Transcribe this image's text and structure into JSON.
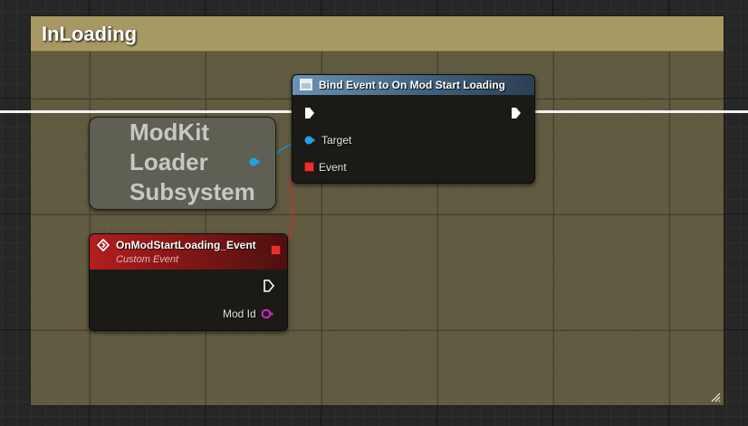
{
  "comment": {
    "title": "InLoading"
  },
  "bind_node": {
    "title": "Bind Event to On Mod Start Loading",
    "pins": {
      "target_label": "Target",
      "event_label": "Event"
    }
  },
  "variable_node": {
    "label": "ModKit Loader Subsystem"
  },
  "event_node": {
    "title": "OnModStartLoading_Event",
    "subtitle": "Custom Event",
    "pins": {
      "mod_id_label": "Mod Id"
    }
  },
  "colors": {
    "comment_header": "#a89963",
    "exec_wire": "#f2f2f2",
    "object_pin": "#20a2e3",
    "delegate_pin": "#ea2f2f",
    "name_pin": "#c82bc8",
    "function_header": "#6a92b4",
    "event_header": "#b21e1e"
  },
  "icons": {
    "function": "function-icon",
    "event": "event-diamond-icon",
    "resize": "resize-grip-icon"
  }
}
